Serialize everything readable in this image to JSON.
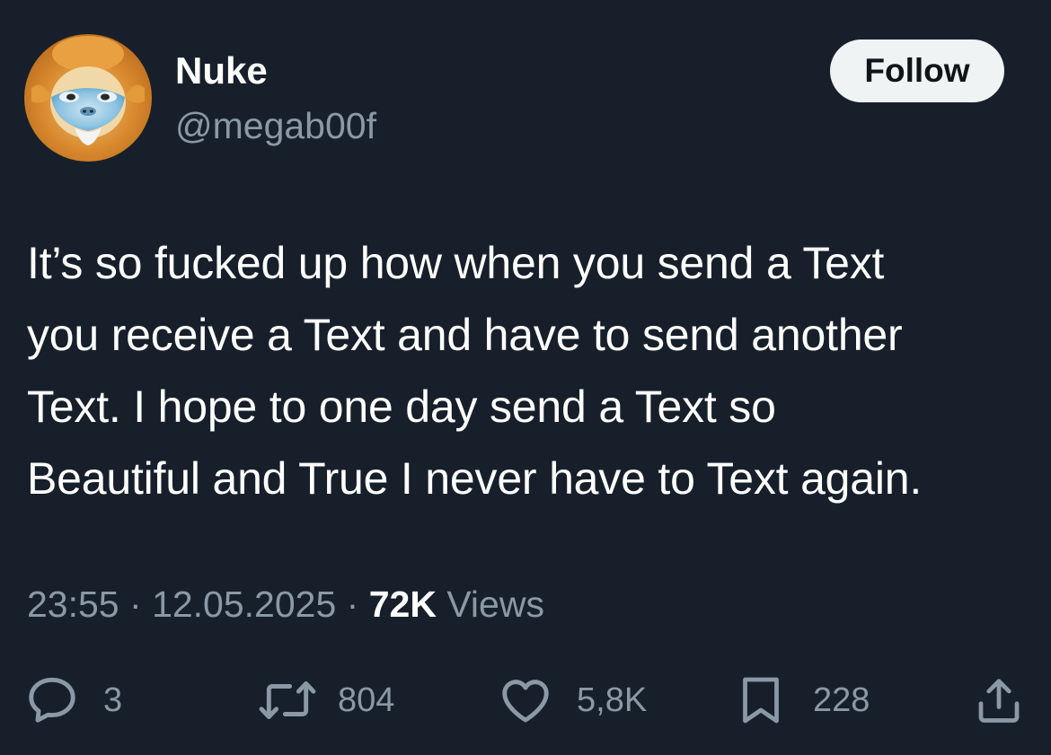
{
  "author": {
    "display_name": "Nuke",
    "handle": "@megab00f",
    "avatar_icon": "golden-snub-nosed-monkey-avatar"
  },
  "follow_button": {
    "label": "Follow"
  },
  "tweet": {
    "lines": [
      "It’s so fucked up how when you send a Text",
      "you receive a Text and have to send another",
      "Text. I hope to one day send a Text so",
      "Beautiful and True I never have to Text again."
    ]
  },
  "meta": {
    "time": "23:55",
    "separator": "·",
    "date": "12.05.2025",
    "views_count": "72K",
    "views_label": "Views"
  },
  "actions": {
    "reply": {
      "icon": "reply-icon",
      "count": "3"
    },
    "retweet": {
      "icon": "retweet-icon",
      "count": "804"
    },
    "like": {
      "icon": "heart-icon",
      "count": "5,8K"
    },
    "bookmark": {
      "icon": "bookmark-icon",
      "count": "228"
    },
    "share": {
      "icon": "share-icon"
    }
  },
  "colors": {
    "background": "#17202a",
    "primary_text": "#ffffff",
    "secondary_text": "#8b98a5",
    "follow_button_bg": "#eff3f4",
    "follow_button_text": "#0f1419"
  }
}
